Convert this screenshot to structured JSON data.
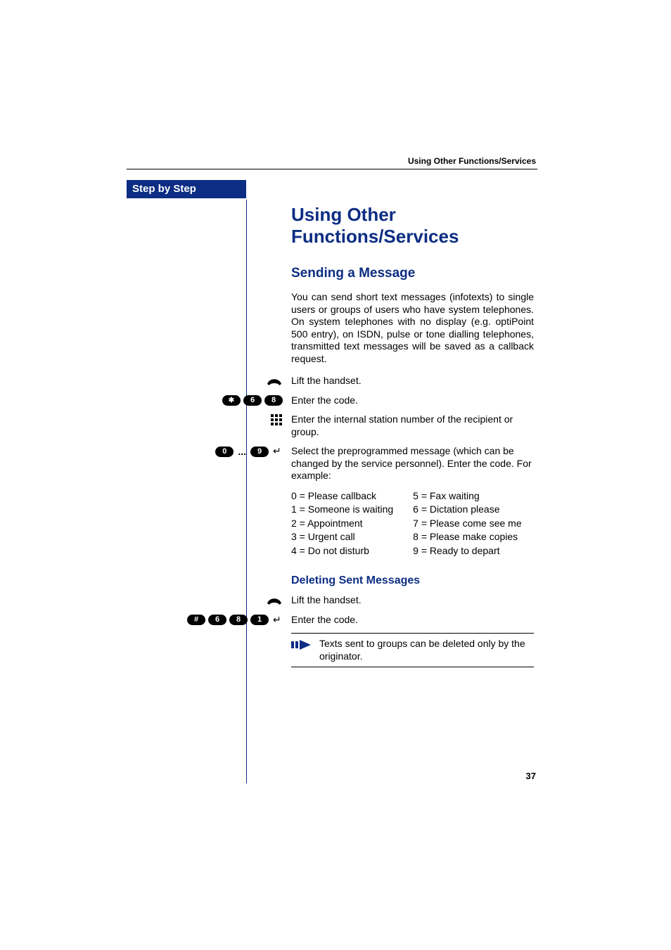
{
  "running_header": "Using Other Functions/Services",
  "sidebar": {
    "step_label": "Step by Step"
  },
  "title": "Using Other Functions/Services",
  "section": "Sending a Message",
  "intro": "You can send short text messages (infotexts) to single users or groups of users who have system telephones. On system telephones with no display (e.g. optiPoint 500 entry), on ISDN, pulse or tone dialling telephones, transmitted text messages will be saved as a callback request.",
  "steps": {
    "lift1": "Lift the handset.",
    "enter_code1": "Enter the code.",
    "enter_station": "Enter the internal station number of the recipient or group.",
    "select_msg": "Select the preprogrammed message (which can be changed by the service personnel). Enter the code. For example:"
  },
  "codes": {
    "send": [
      "*",
      "6",
      "8"
    ],
    "range_low": "0",
    "range_high": "9",
    "range_sep": "...",
    "delete": [
      "#",
      "6",
      "8",
      "1"
    ]
  },
  "messages_col1": [
    "0 = Please callback",
    "1 = Someone is waiting",
    "2 = Appointment",
    "3 = Urgent call",
    "4 = Do not disturb"
  ],
  "messages_col2": [
    "5 = Fax waiting",
    "6 = Dictation please",
    "7 = Please come see me",
    "8 = Please make copies",
    "9 = Ready to depart"
  ],
  "subsection": "Deleting Sent Messages",
  "steps2": {
    "lift2": "Lift the handset.",
    "enter_code2": "Enter the code."
  },
  "note": "Texts sent to groups can be deleted only by the originator.",
  "page_number": "37"
}
